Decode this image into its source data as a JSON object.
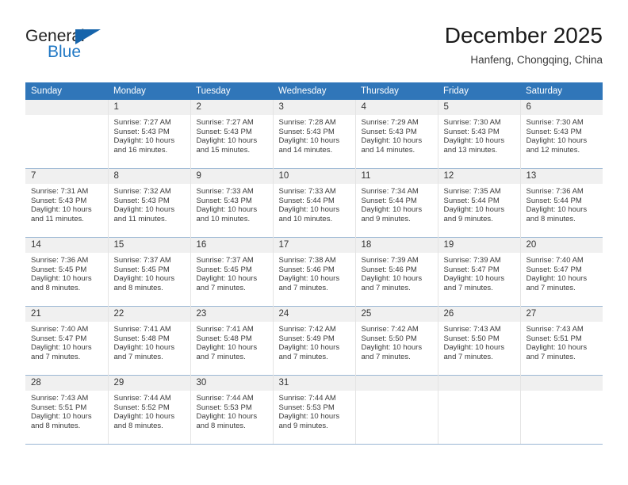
{
  "brand": {
    "name_part1": "General",
    "name_part2": "Blue",
    "accent_color": "#1664ab",
    "blue_text_color": "#1f77c4"
  },
  "header": {
    "month_title": "December 2025",
    "location": "Hanfeng, Chongqing, China"
  },
  "calendar": {
    "header_color": "#3076b9",
    "daynum_band_color": "#f0f0f0",
    "weekday_headers": [
      "Sunday",
      "Monday",
      "Tuesday",
      "Wednesday",
      "Thursday",
      "Friday",
      "Saturday"
    ],
    "weeks": [
      [
        {
          "day": "",
          "sunrise": "",
          "sunset": "",
          "daylight": "",
          "empty": true
        },
        {
          "day": "1",
          "sunrise": "Sunrise: 7:27 AM",
          "sunset": "Sunset: 5:43 PM",
          "daylight": "Daylight: 10 hours and 16 minutes."
        },
        {
          "day": "2",
          "sunrise": "Sunrise: 7:27 AM",
          "sunset": "Sunset: 5:43 PM",
          "daylight": "Daylight: 10 hours and 15 minutes."
        },
        {
          "day": "3",
          "sunrise": "Sunrise: 7:28 AM",
          "sunset": "Sunset: 5:43 PM",
          "daylight": "Daylight: 10 hours and 14 minutes."
        },
        {
          "day": "4",
          "sunrise": "Sunrise: 7:29 AM",
          "sunset": "Sunset: 5:43 PM",
          "daylight": "Daylight: 10 hours and 14 minutes."
        },
        {
          "day": "5",
          "sunrise": "Sunrise: 7:30 AM",
          "sunset": "Sunset: 5:43 PM",
          "daylight": "Daylight: 10 hours and 13 minutes."
        },
        {
          "day": "6",
          "sunrise": "Sunrise: 7:30 AM",
          "sunset": "Sunset: 5:43 PM",
          "daylight": "Daylight: 10 hours and 12 minutes."
        }
      ],
      [
        {
          "day": "7",
          "sunrise": "Sunrise: 7:31 AM",
          "sunset": "Sunset: 5:43 PM",
          "daylight": "Daylight: 10 hours and 11 minutes."
        },
        {
          "day": "8",
          "sunrise": "Sunrise: 7:32 AM",
          "sunset": "Sunset: 5:43 PM",
          "daylight": "Daylight: 10 hours and 11 minutes."
        },
        {
          "day": "9",
          "sunrise": "Sunrise: 7:33 AM",
          "sunset": "Sunset: 5:43 PM",
          "daylight": "Daylight: 10 hours and 10 minutes."
        },
        {
          "day": "10",
          "sunrise": "Sunrise: 7:33 AM",
          "sunset": "Sunset: 5:44 PM",
          "daylight": "Daylight: 10 hours and 10 minutes."
        },
        {
          "day": "11",
          "sunrise": "Sunrise: 7:34 AM",
          "sunset": "Sunset: 5:44 PM",
          "daylight": "Daylight: 10 hours and 9 minutes."
        },
        {
          "day": "12",
          "sunrise": "Sunrise: 7:35 AM",
          "sunset": "Sunset: 5:44 PM",
          "daylight": "Daylight: 10 hours and 9 minutes."
        },
        {
          "day": "13",
          "sunrise": "Sunrise: 7:36 AM",
          "sunset": "Sunset: 5:44 PM",
          "daylight": "Daylight: 10 hours and 8 minutes."
        }
      ],
      [
        {
          "day": "14",
          "sunrise": "Sunrise: 7:36 AM",
          "sunset": "Sunset: 5:45 PM",
          "daylight": "Daylight: 10 hours and 8 minutes."
        },
        {
          "day": "15",
          "sunrise": "Sunrise: 7:37 AM",
          "sunset": "Sunset: 5:45 PM",
          "daylight": "Daylight: 10 hours and 8 minutes."
        },
        {
          "day": "16",
          "sunrise": "Sunrise: 7:37 AM",
          "sunset": "Sunset: 5:45 PM",
          "daylight": "Daylight: 10 hours and 7 minutes."
        },
        {
          "day": "17",
          "sunrise": "Sunrise: 7:38 AM",
          "sunset": "Sunset: 5:46 PM",
          "daylight": "Daylight: 10 hours and 7 minutes."
        },
        {
          "day": "18",
          "sunrise": "Sunrise: 7:39 AM",
          "sunset": "Sunset: 5:46 PM",
          "daylight": "Daylight: 10 hours and 7 minutes."
        },
        {
          "day": "19",
          "sunrise": "Sunrise: 7:39 AM",
          "sunset": "Sunset: 5:47 PM",
          "daylight": "Daylight: 10 hours and 7 minutes."
        },
        {
          "day": "20",
          "sunrise": "Sunrise: 7:40 AM",
          "sunset": "Sunset: 5:47 PM",
          "daylight": "Daylight: 10 hours and 7 minutes."
        }
      ],
      [
        {
          "day": "21",
          "sunrise": "Sunrise: 7:40 AM",
          "sunset": "Sunset: 5:47 PM",
          "daylight": "Daylight: 10 hours and 7 minutes."
        },
        {
          "day": "22",
          "sunrise": "Sunrise: 7:41 AM",
          "sunset": "Sunset: 5:48 PM",
          "daylight": "Daylight: 10 hours and 7 minutes."
        },
        {
          "day": "23",
          "sunrise": "Sunrise: 7:41 AM",
          "sunset": "Sunset: 5:48 PM",
          "daylight": "Daylight: 10 hours and 7 minutes."
        },
        {
          "day": "24",
          "sunrise": "Sunrise: 7:42 AM",
          "sunset": "Sunset: 5:49 PM",
          "daylight": "Daylight: 10 hours and 7 minutes."
        },
        {
          "day": "25",
          "sunrise": "Sunrise: 7:42 AM",
          "sunset": "Sunset: 5:50 PM",
          "daylight": "Daylight: 10 hours and 7 minutes."
        },
        {
          "day": "26",
          "sunrise": "Sunrise: 7:43 AM",
          "sunset": "Sunset: 5:50 PM",
          "daylight": "Daylight: 10 hours and 7 minutes."
        },
        {
          "day": "27",
          "sunrise": "Sunrise: 7:43 AM",
          "sunset": "Sunset: 5:51 PM",
          "daylight": "Daylight: 10 hours and 7 minutes."
        }
      ],
      [
        {
          "day": "28",
          "sunrise": "Sunrise: 7:43 AM",
          "sunset": "Sunset: 5:51 PM",
          "daylight": "Daylight: 10 hours and 8 minutes."
        },
        {
          "day": "29",
          "sunrise": "Sunrise: 7:44 AM",
          "sunset": "Sunset: 5:52 PM",
          "daylight": "Daylight: 10 hours and 8 minutes."
        },
        {
          "day": "30",
          "sunrise": "Sunrise: 7:44 AM",
          "sunset": "Sunset: 5:53 PM",
          "daylight": "Daylight: 10 hours and 8 minutes."
        },
        {
          "day": "31",
          "sunrise": "Sunrise: 7:44 AM",
          "sunset": "Sunset: 5:53 PM",
          "daylight": "Daylight: 10 hours and 9 minutes."
        },
        {
          "day": "",
          "sunrise": "",
          "sunset": "",
          "daylight": "",
          "empty": true
        },
        {
          "day": "",
          "sunrise": "",
          "sunset": "",
          "daylight": "",
          "empty": true
        },
        {
          "day": "",
          "sunrise": "",
          "sunset": "",
          "daylight": "",
          "empty": true
        }
      ]
    ]
  }
}
